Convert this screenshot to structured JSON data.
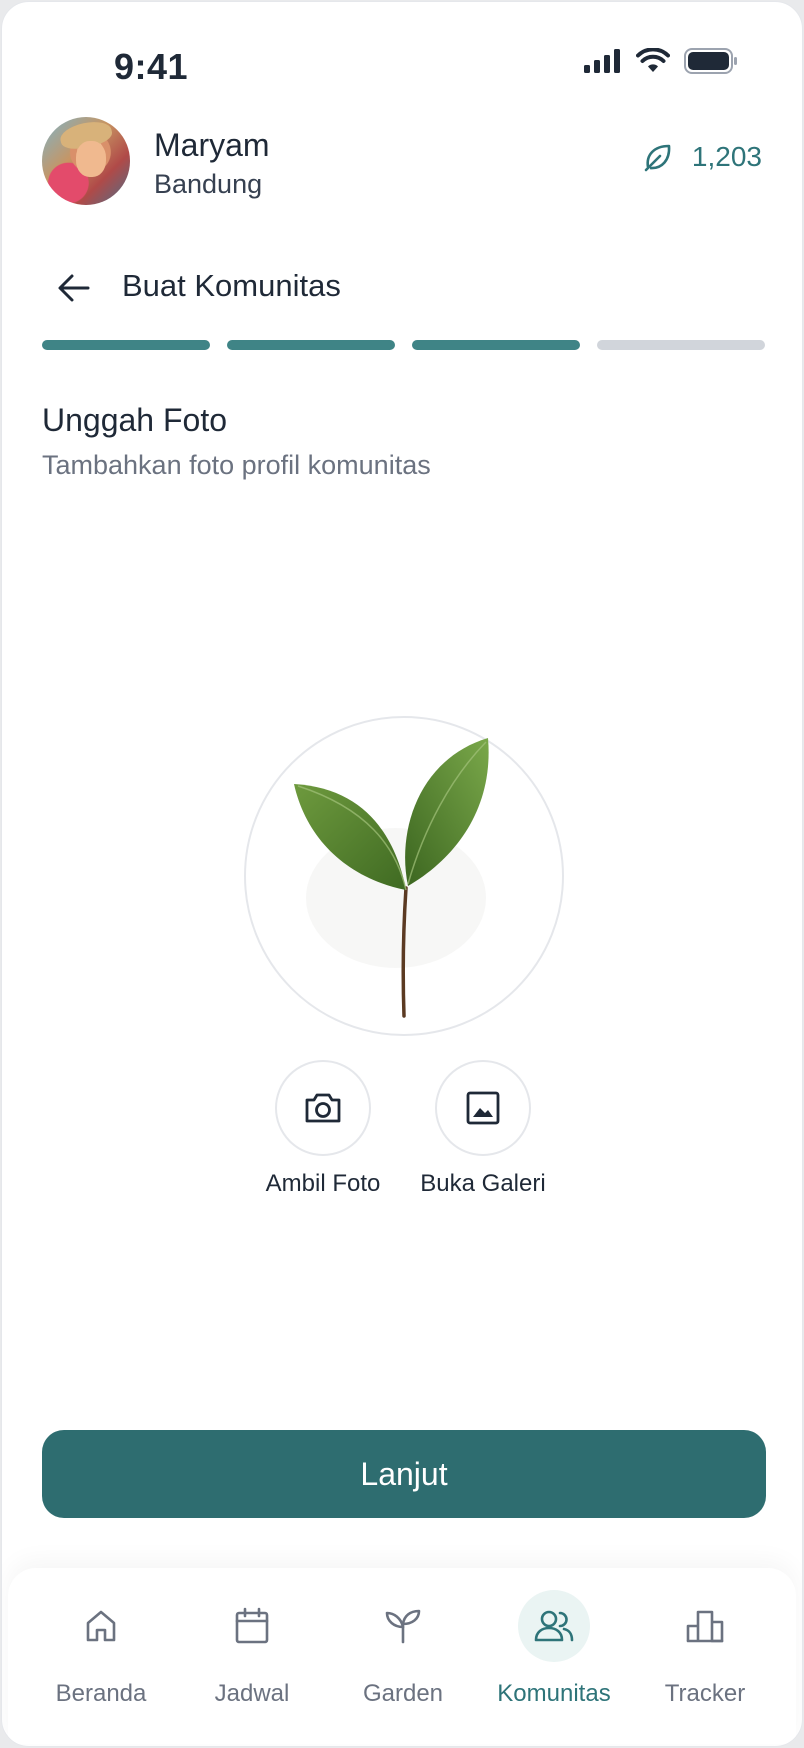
{
  "status_bar": {
    "time": "9:41"
  },
  "profile": {
    "name": "Maryam",
    "city": "Bandung",
    "points": "1,203"
  },
  "page": {
    "title": "Buat Komunitas"
  },
  "progress": {
    "current_step": 3,
    "total_steps": 4
  },
  "section": {
    "title": "Unggah Foto",
    "subtitle": "Tambahkan foto profil komunitas"
  },
  "upload_options": [
    {
      "label": "Ambil Foto",
      "icon": "camera-icon"
    },
    {
      "label": "Buka Galeri",
      "icon": "image-icon"
    }
  ],
  "next_button": {
    "label": "Lanjut"
  },
  "bottom_nav": {
    "active": "Komunitas",
    "items": [
      {
        "label": "Beranda",
        "icon": "home-icon"
      },
      {
        "label": "Jadwal",
        "icon": "calendar-icon"
      },
      {
        "label": "Garden",
        "icon": "sprout-icon"
      },
      {
        "label": "Komunitas",
        "icon": "users-icon"
      },
      {
        "label": "Tracker",
        "icon": "bar-chart-icon"
      }
    ]
  },
  "colors": {
    "accent": "#2e6d70",
    "accent_text": "#2e7479",
    "progress_done": "#3f8486",
    "progress_todo": "#d1d5db"
  }
}
